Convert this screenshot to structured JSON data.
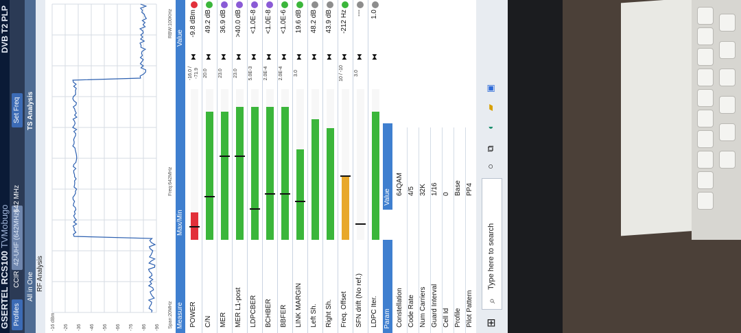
{
  "app": {
    "title": "GSERTEL RCS100",
    "subtitle": "TVMobugo",
    "dvb_logo": "DVB T2 PLP",
    "toolbar": {
      "profiles": "Profiles",
      "standard": "CCIR",
      "channel": "42-UHF (642MHz)",
      "freq": "642 MHz",
      "set_freq": "Set Freq"
    },
    "tabs": {
      "all_in_one": "All in One",
      "ts_analysis": "TS Analysis",
      "rf_analysis": "RF Analysis"
    }
  },
  "spectrum": {
    "y_ticks": [
      "-16 dBm",
      "-26",
      "-36",
      "-46",
      "-56",
      "-66",
      "-76",
      "-86",
      "-96"
    ],
    "span": "Span:20MHz",
    "center": "Freq:642MHz",
    "rbw": "RBW:100KHz"
  },
  "measure": {
    "headers": {
      "measure": "Measure",
      "maxmin": "Max/Min",
      "value": "Value"
    },
    "rows": [
      {
        "label": "POWER",
        "small": "-16.0 / -71.9",
        "value": "-9.8 dBm",
        "level": 0.18,
        "mark": 0.08,
        "bar": "#e2303a",
        "dot": "#e2303a"
      },
      {
        "label": "C/N",
        "small": "20.0",
        "value": "49.2 dB",
        "level": 0.85,
        "mark": 0.28,
        "bar": "#3bb63b",
        "dot": "#3bb63b"
      },
      {
        "label": "MER",
        "small": "23.0",
        "value": "36.9 dB",
        "level": 0.85,
        "mark": 0.55,
        "bar": "#3bb63b",
        "dot": "#8a5bd6"
      },
      {
        "label": "MER L1-post",
        "small": "23.0",
        "value": ">40.0 dB",
        "level": 0.88,
        "mark": 0.55,
        "bar": "#3bb63b",
        "dot": "#8a5bd6"
      },
      {
        "label": "LDPCBER",
        "small": "5.0E-3",
        "value": "<1.0E-8",
        "level": 0.88,
        "mark": 0.2,
        "bar": "#3bb63b",
        "dot": "#8a5bd6"
      },
      {
        "label": "BCHBER",
        "small": "2.0E-4",
        "value": "<1.0E-8",
        "level": 0.88,
        "mark": 0.3,
        "bar": "#3bb63b",
        "dot": "#8a5bd6"
      },
      {
        "label": "BBFER",
        "small": "2.0E-4",
        "value": "<1.0E-6",
        "level": 0.88,
        "mark": 0.3,
        "bar": "#3bb63b",
        "dot": "#3bb63b"
      },
      {
        "label": "LINK MARGIN",
        "small": "3.0",
        "value": "19.6 dB",
        "level": 0.6,
        "mark": 0.25,
        "bar": "#3bb63b",
        "dot": "#3bb63b"
      },
      {
        "label": "Left Sh.",
        "small": "",
        "value": "48.2 dB",
        "level": 0.8,
        "mark": -1,
        "bar": "#3bb63b",
        "dot": "#8d8d8d"
      },
      {
        "label": "Right Sh.",
        "small": "",
        "value": "43.9 dB",
        "level": 0.74,
        "mark": -1,
        "bar": "#3bb63b",
        "dot": "#8d8d8d"
      },
      {
        "label": "Freq. Offset",
        "small": "10 / -10",
        "value": "-212 Hz",
        "level": 0.42,
        "mark": 0.42,
        "bar": "#e8a82a",
        "dot": "#3bb63b"
      },
      {
        "label": "SFN drift (No ref.)",
        "small": "3.0",
        "value": "---",
        "level": 0.0,
        "mark": 0.1,
        "bar": "#3bb63b",
        "dot": "#8d8d8d"
      },
      {
        "label": "LDPC Iter.",
        "small": "",
        "value": "1.0",
        "level": 0.85,
        "mark": -1,
        "bar": "#3bb63b",
        "dot": "#8d8d8d"
      }
    ]
  },
  "param": {
    "headers": {
      "param": "Param",
      "value": "Value"
    },
    "rows": [
      {
        "label": "Constellation",
        "value": "64QAM"
      },
      {
        "label": "Code Rate",
        "value": "4/5"
      },
      {
        "label": "Num Carriers",
        "value": "32K"
      },
      {
        "label": "Guard Interval",
        "value": "1/16"
      },
      {
        "label": "Cell Id",
        "value": "0"
      },
      {
        "label": "Profile",
        "value": "Base"
      },
      {
        "label": "Pilot Pattern",
        "value": "PP4"
      }
    ]
  },
  "taskbar": {
    "search_placeholder": "Type here to search"
  },
  "colors": {
    "header": "#3f7fcf",
    "titlebar": "#0a1a36",
    "ok": "#3bb63b",
    "warn": "#e8a82a",
    "alarm": "#e2303a"
  },
  "icons": [
    "windows-icon",
    "search-icon",
    "cortana-icon",
    "task-view-icon",
    "edge-icon",
    "folder-icon",
    "store-icon"
  ]
}
